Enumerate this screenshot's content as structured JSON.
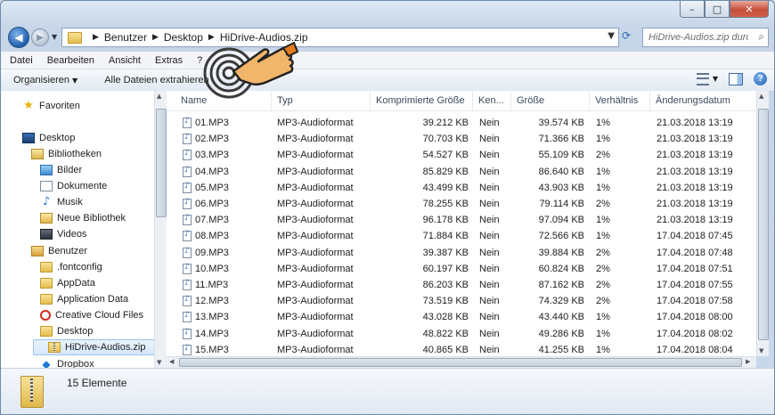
{
  "window": {
    "controls": {
      "minimize": "–",
      "maximize": "□",
      "close": "✕"
    }
  },
  "address": {
    "crumbs": [
      "Benutzer",
      "Desktop",
      "HiDrive-Audios.zip"
    ],
    "search_placeholder": "HiDrive-Audios.zip durchsuchen"
  },
  "menu": [
    "Datei",
    "Bearbeiten",
    "Ansicht",
    "Extras",
    "?"
  ],
  "toolbar": {
    "organize": "Organisieren",
    "extract_all": "Alle Dateien extrahieren"
  },
  "nav": {
    "items": [
      {
        "label": "Favoriten",
        "icon": "star-icon"
      },
      {
        "label": "Desktop",
        "icon": "desktop-icon"
      },
      {
        "label": "Bibliotheken",
        "icon": "libraries-icon"
      },
      {
        "label": "Bilder",
        "icon": "pictures-icon"
      },
      {
        "label": "Dokumente",
        "icon": "documents-icon"
      },
      {
        "label": "Musik",
        "icon": "music-icon"
      },
      {
        "label": "Neue Bibliothek",
        "icon": "library-icon"
      },
      {
        "label": "Videos",
        "icon": "videos-icon"
      },
      {
        "label": "Benutzer",
        "icon": "user-folder-icon"
      },
      {
        "label": ".fontconfig",
        "icon": "folder-icon"
      },
      {
        "label": "AppData",
        "icon": "folder-icon"
      },
      {
        "label": "Application Data",
        "icon": "folder-icon"
      },
      {
        "label": "Creative Cloud Files",
        "icon": "creative-cloud-icon"
      },
      {
        "label": "Desktop",
        "icon": "folder-icon"
      },
      {
        "label": "HiDrive-Audios.zip",
        "icon": "zip-folder-icon"
      },
      {
        "label": "Dropbox",
        "icon": "dropbox-icon"
      }
    ]
  },
  "columns": [
    "Name",
    "Typ",
    "Komprimierte Größe",
    "Ken...",
    "Größe",
    "Verhältnis",
    "Änderungsdatum"
  ],
  "files": [
    {
      "name": "01.MP3",
      "type": "MP3-Audioformat",
      "compressed": "39.212 KB",
      "pw": "Nein",
      "size": "39.574 KB",
      "ratio": "1%",
      "date": "21.03.2018 13:19"
    },
    {
      "name": "02.MP3",
      "type": "MP3-Audioformat",
      "compressed": "70.703 KB",
      "pw": "Nein",
      "size": "71.366 KB",
      "ratio": "1%",
      "date": "21.03.2018 13:19"
    },
    {
      "name": "03.MP3",
      "type": "MP3-Audioformat",
      "compressed": "54.527 KB",
      "pw": "Nein",
      "size": "55.109 KB",
      "ratio": "2%",
      "date": "21.03.2018 13:19"
    },
    {
      "name": "04.MP3",
      "type": "MP3-Audioformat",
      "compressed": "85.829 KB",
      "pw": "Nein",
      "size": "86.640 KB",
      "ratio": "1%",
      "date": "21.03.2018 13:19"
    },
    {
      "name": "05.MP3",
      "type": "MP3-Audioformat",
      "compressed": "43.499 KB",
      "pw": "Nein",
      "size": "43.903 KB",
      "ratio": "1%",
      "date": "21.03.2018 13:19"
    },
    {
      "name": "06.MP3",
      "type": "MP3-Audioformat",
      "compressed": "78.255 KB",
      "pw": "Nein",
      "size": "79.114 KB",
      "ratio": "2%",
      "date": "21.03.2018 13:19"
    },
    {
      "name": "07.MP3",
      "type": "MP3-Audioformat",
      "compressed": "96.178 KB",
      "pw": "Nein",
      "size": "97.094 KB",
      "ratio": "1%",
      "date": "21.03.2018 13:19"
    },
    {
      "name": "08.MP3",
      "type": "MP3-Audioformat",
      "compressed": "71.884 KB",
      "pw": "Nein",
      "size": "72.566 KB",
      "ratio": "1%",
      "date": "17.04.2018 07:45"
    },
    {
      "name": "09.MP3",
      "type": "MP3-Audioformat",
      "compressed": "39.387 KB",
      "pw": "Nein",
      "size": "39.884 KB",
      "ratio": "2%",
      "date": "17.04.2018 07:48"
    },
    {
      "name": "10.MP3",
      "type": "MP3-Audioformat",
      "compressed": "60.197 KB",
      "pw": "Nein",
      "size": "60.824 KB",
      "ratio": "2%",
      "date": "17.04.2018 07:51"
    },
    {
      "name": "11.MP3",
      "type": "MP3-Audioformat",
      "compressed": "86.203 KB",
      "pw": "Nein",
      "size": "87.162 KB",
      "ratio": "2%",
      "date": "17.04.2018 07:55"
    },
    {
      "name": "12.MP3",
      "type": "MP3-Audioformat",
      "compressed": "73.519 KB",
      "pw": "Nein",
      "size": "74.329 KB",
      "ratio": "2%",
      "date": "17.04.2018 07:58"
    },
    {
      "name": "13.MP3",
      "type": "MP3-Audioformat",
      "compressed": "43.028 KB",
      "pw": "Nein",
      "size": "43.440 KB",
      "ratio": "1%",
      "date": "17.04.2018 08:00"
    },
    {
      "name": "14.MP3",
      "type": "MP3-Audioformat",
      "compressed": "48.822 KB",
      "pw": "Nein",
      "size": "49.286 KB",
      "ratio": "1%",
      "date": "17.04.2018 08:02"
    },
    {
      "name": "15.MP3",
      "type": "MP3-Audioformat",
      "compressed": "40.865 KB",
      "pw": "Nein",
      "size": "41.255 KB",
      "ratio": "1%",
      "date": "17.04.2018 08:04"
    }
  ],
  "status": {
    "count": "15 Elemente"
  }
}
